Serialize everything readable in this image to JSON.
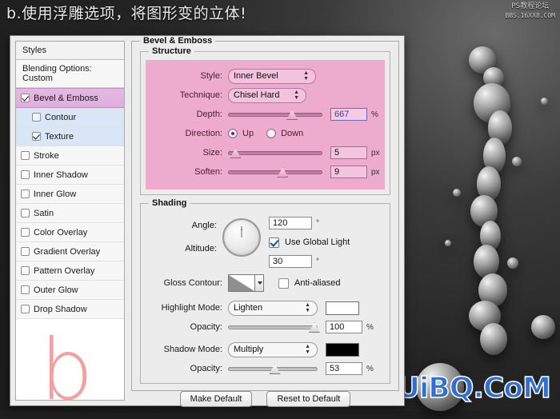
{
  "caption": "b.使用浮雕选项，将图形变的立体!",
  "watermark_top": {
    "line1": "PS教程论坛",
    "line2": "BBS.16XX8.COM"
  },
  "watermark_bottom": "UiBQ.CoM",
  "preview_letter": "b",
  "colors": {
    "selection": "#e0b0dd",
    "sub_selection": "#d9e6f5",
    "structure_overlay": "#edaccd",
    "highlight_field": "#f6cbe3",
    "shadow_swatch": "#000000",
    "highlight_swatch": "#ffffff",
    "preview_letter": "#f2a0a0",
    "wm_blue": "#2f6fd0"
  },
  "sidebar": {
    "header": "Styles",
    "blending_options": "Blending Options: Custom",
    "items": [
      {
        "label": "Bevel & Emboss",
        "checked": true,
        "selected": true,
        "sub": false
      },
      {
        "label": "Contour",
        "checked": false,
        "selected": false,
        "sub": true
      },
      {
        "label": "Texture",
        "checked": true,
        "selected": false,
        "sub": true
      },
      {
        "label": "Stroke",
        "checked": false,
        "selected": false,
        "sub": false
      },
      {
        "label": "Inner Shadow",
        "checked": false,
        "selected": false,
        "sub": false
      },
      {
        "label": "Inner Glow",
        "checked": false,
        "selected": false,
        "sub": false
      },
      {
        "label": "Satin",
        "checked": false,
        "selected": false,
        "sub": false
      },
      {
        "label": "Color Overlay",
        "checked": false,
        "selected": false,
        "sub": false
      },
      {
        "label": "Gradient Overlay",
        "checked": false,
        "selected": false,
        "sub": false
      },
      {
        "label": "Pattern Overlay",
        "checked": false,
        "selected": false,
        "sub": false
      },
      {
        "label": "Outer Glow",
        "checked": false,
        "selected": false,
        "sub": false
      },
      {
        "label": "Drop Shadow",
        "checked": false,
        "selected": false,
        "sub": false
      }
    ]
  },
  "panel": {
    "title": "Bevel & Emboss",
    "structure": {
      "legend": "Structure",
      "style_label": "Style:",
      "style_value": "Inner Bevel",
      "technique_label": "Technique:",
      "technique_value": "Chisel Hard",
      "depth_label": "Depth:",
      "depth_value": "667",
      "depth_unit": "%",
      "depth_pct": 62,
      "direction_label": "Direction:",
      "direction_up": "Up",
      "direction_down": "Down",
      "direction_selected": "Up",
      "size_label": "Size:",
      "size_value": "5",
      "size_unit": "px",
      "size_pct": 4,
      "soften_label": "Soften:",
      "soften_value": "9",
      "soften_unit": "px",
      "soften_pct": 53
    },
    "shading": {
      "legend": "Shading",
      "angle_label": "Angle:",
      "angle_value": "120",
      "angle_unit": "°",
      "use_global_light_label": "Use Global Light",
      "use_global_light": true,
      "altitude_label": "Altitude:",
      "altitude_value": "30",
      "altitude_unit": "°",
      "gloss_contour_label": "Gloss Contour:",
      "anti_aliased_label": "Anti-aliased",
      "anti_aliased": false,
      "highlight_mode_label": "Highlight Mode:",
      "highlight_mode_value": "Lighten",
      "highlight_opacity_label": "Opacity:",
      "highlight_opacity_value": "100",
      "highlight_opacity_unit": "%",
      "highlight_opacity_pct": 91,
      "shadow_mode_label": "Shadow Mode:",
      "shadow_mode_value": "Multiply",
      "shadow_opacity_label": "Opacity:",
      "shadow_opacity_value": "53",
      "shadow_opacity_unit": "%",
      "shadow_opacity_pct": 48
    }
  },
  "footer": {
    "make_default": "Make Default",
    "reset_to_default": "Reset to Default"
  }
}
